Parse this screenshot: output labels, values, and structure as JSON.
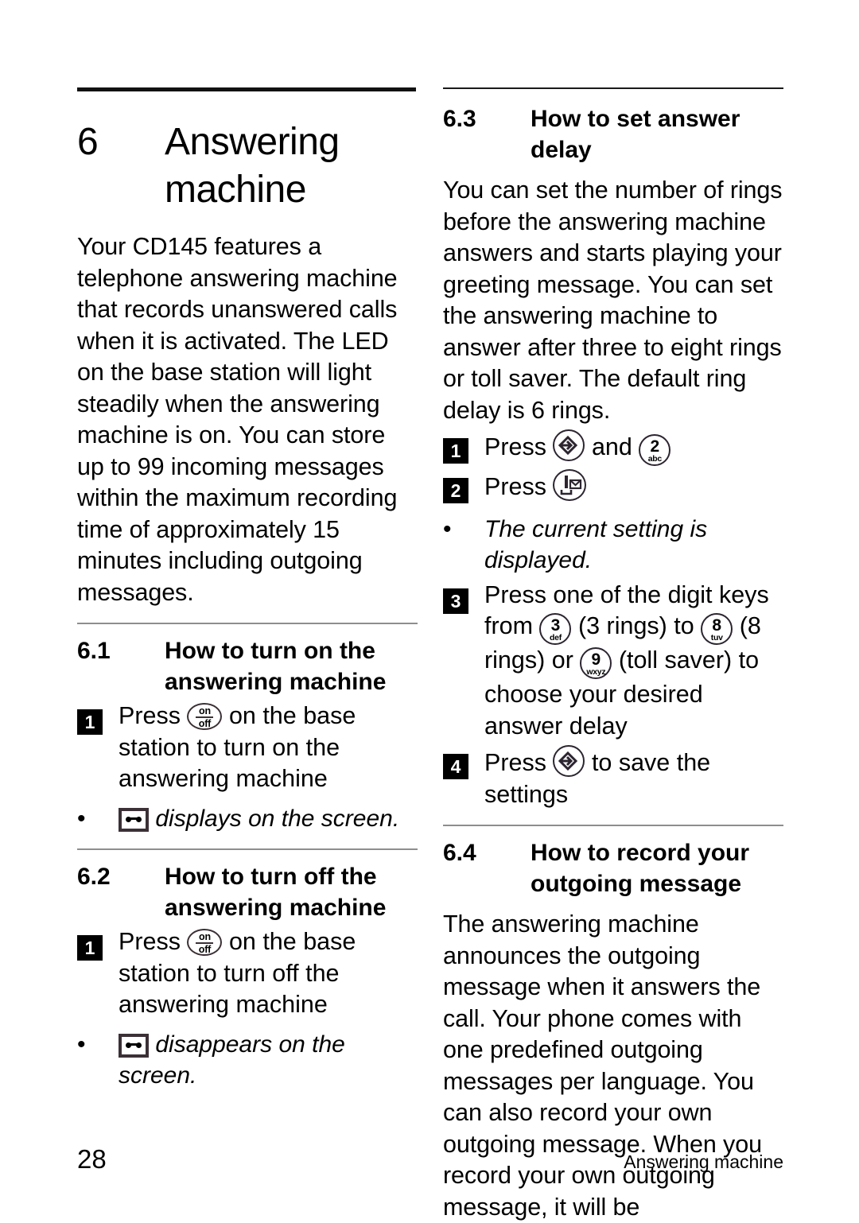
{
  "page": {
    "folio": "28",
    "running_head": "Answering machine"
  },
  "chapter": {
    "number": "6",
    "title": "Answering machine"
  },
  "left_column": {
    "intro": "Your CD145 features a telephone answering machine that records unanswered calls when it is activated. The LED on the base station will light steadily when the answering machine is on. You can store up to 99 incoming messages within the maximum recording time of approximately 15 minutes including outgoing messages.",
    "sections": [
      {
        "number": "6.1",
        "title": "How to turn on the answering machine",
        "step_number": "1",
        "step_text_before": "Press",
        "step_text_after": "on the base station to turn on the answering machine",
        "note_text": "displays on the screen."
      },
      {
        "number": "6.2",
        "title": "How to turn off the answering machine",
        "step_number": "1",
        "step_text_before": "Press",
        "step_text_after": "on the base station to turn off the answering machine",
        "note_text": "disappears on the screen."
      }
    ]
  },
  "right_column": {
    "sections": [
      {
        "number": "6.3",
        "title": "How to set answer delay",
        "intro": "You can set the number of rings before the answering machine answers and starts playing your greeting message. You can set the answering machine to answer after three to eight rings or toll saver. The default ring delay is 6 rings.",
        "steps": [
          {
            "number": "1",
            "text_before": "Press",
            "text_middle": "and",
            "text_after": ""
          },
          {
            "number": "2",
            "text_before": "Press",
            "text_after": ""
          },
          {
            "number": "3",
            "text_a": "Press one of the digit keys from",
            "text_b": "(3 rings) to",
            "text_c": "(8 rings) or",
            "text_d": "(toll saver) to choose your desired answer delay"
          },
          {
            "number": "4",
            "text_before": "Press",
            "text_after": "to save the settings"
          }
        ],
        "note_text": "The current setting is displayed."
      },
      {
        "number": "6.4",
        "title": "How to record your outgoing message",
        "intro": "The answering machine announces the outgoing message when it answers the call. Your phone comes with one predefined outgoing messages per language. You can also record your own outgoing message. When you record your own outgoing message, it will be"
      }
    ]
  },
  "keys": {
    "onoff": {
      "name": "on-off-key",
      "on": "on",
      "off": "off"
    },
    "menu": {
      "name": "menu-select-key"
    },
    "answering_machine": {
      "name": "answering-machine-key"
    },
    "digit_2": {
      "name": "digit-2-key",
      "digit": "2",
      "letters": "abc"
    },
    "digit_3": {
      "name": "digit-3-key",
      "digit": "3",
      "letters": "def"
    },
    "digit_8": {
      "name": "digit-8-key",
      "digit": "8",
      "letters": "tuv"
    },
    "digit_9": {
      "name": "digit-9-key",
      "digit": "9",
      "letters": "wxyz"
    },
    "tape": {
      "name": "cassette-tape-icon"
    }
  },
  "colors": {
    "text": "#000000",
    "rule_dark": "#111111",
    "rule_light": "#8e8e8e",
    "icon_outline": "#3b3036"
  }
}
